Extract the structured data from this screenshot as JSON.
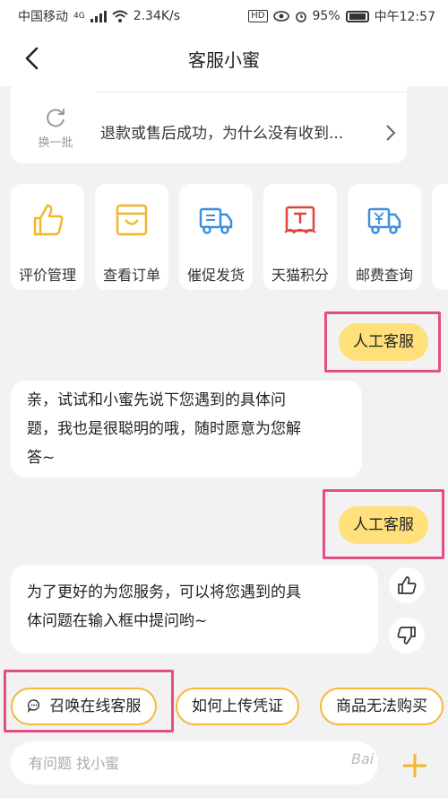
{
  "status": {
    "carrier": "中国移动",
    "net_type": "4G",
    "speed": "2.34K/s",
    "hd": "HD",
    "battery": "95%",
    "time": "中午12:57"
  },
  "header": {
    "title": "客服小蜜"
  },
  "question_card": {
    "refresh_label": "换一批",
    "question": "退款或售后成功，为什么没有收到..."
  },
  "shortcuts": [
    {
      "label": "评价管理",
      "icon": "thumbs-up-icon"
    },
    {
      "label": "查看订单",
      "icon": "order-bag-icon"
    },
    {
      "label": "催促发货",
      "icon": "delivery-truck-icon"
    },
    {
      "label": "天猫积分",
      "icon": "tmall-points-icon"
    },
    {
      "label": "邮费查询",
      "icon": "postage-truck-icon"
    }
  ],
  "conversation": {
    "user_msg_1": "人工客服",
    "bot_msg_1_lines": [
      "亲，试试和小蜜先说下您遇到的具体问",
      "题，我也是很聪明的哦，随时愿意为您解",
      "答~"
    ],
    "user_msg_2": "人工客服",
    "bot_msg_2_lines": [
      "为了更好的为您服务，可以将您遇到的具",
      "体问题在输入框中提问哟~"
    ]
  },
  "chips": [
    {
      "label": "召唤在线客服",
      "icon": "chat-bubble-icon"
    },
    {
      "label": "如何上传凭证"
    },
    {
      "label": "商品无法购买"
    }
  ],
  "input": {
    "placeholder": "有问题 找小蜜"
  },
  "watermark": "Bai"
}
